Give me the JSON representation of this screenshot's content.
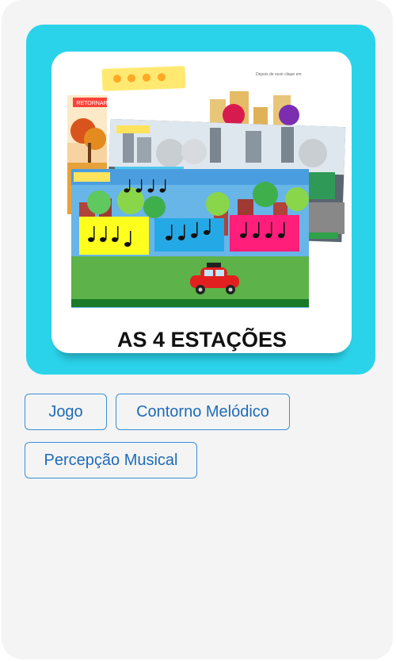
{
  "product": {
    "title_art": "AS 4 ESTAÇÕES",
    "back_button_label": "RETORNAR",
    "small_top_text": "Depois de ouvir clique em"
  },
  "tags": [
    {
      "label": "Jogo"
    },
    {
      "label": "Contorno Melódico"
    },
    {
      "label": "Percepção Musical"
    }
  ],
  "colors": {
    "frame": "#2bd3ea",
    "tag_border": "#3b8fd9",
    "tag_text": "#1e6bb8",
    "card_bg": "#f4f4f4"
  }
}
